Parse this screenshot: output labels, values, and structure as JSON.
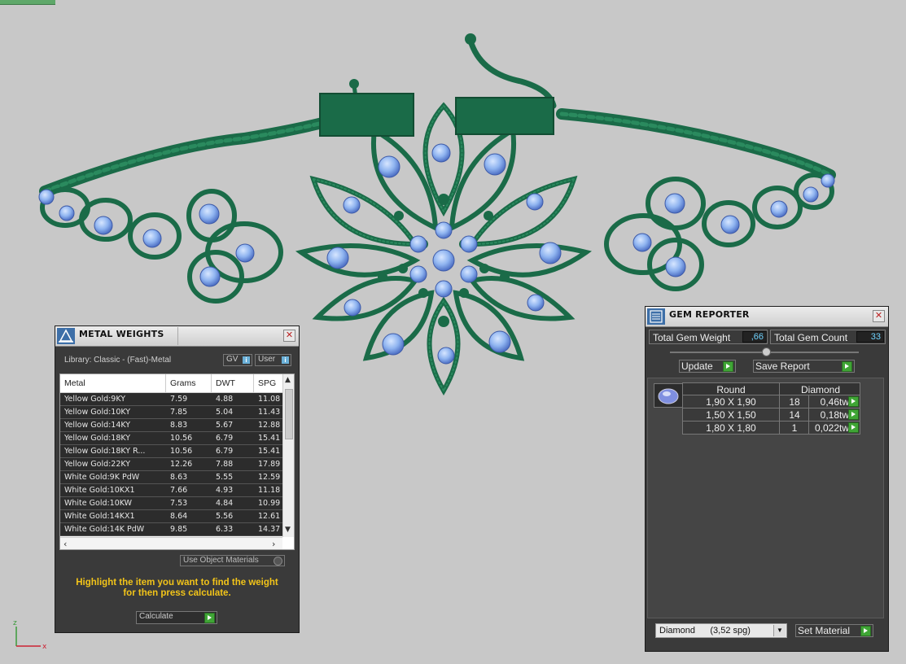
{
  "metal_weights": {
    "title": "METAL WEIGHTS",
    "library": "Library: Classic - (Fast)-Metal",
    "toggle_gv": "GV",
    "toggle_user": "User",
    "columns": [
      "Metal",
      "Grams",
      "DWT",
      "SPG"
    ],
    "rows": [
      [
        "Yellow Gold:9KY",
        "7.59",
        "4.88",
        "11.08"
      ],
      [
        "Yellow Gold:10KY",
        "7.85",
        "5.04",
        "11.43"
      ],
      [
        "Yellow Gold:14KY",
        "8.83",
        "5.67",
        "12.88"
      ],
      [
        "Yellow Gold:18KY",
        "10.56",
        "6.79",
        "15.41"
      ],
      [
        "Yellow Gold:18KY R...",
        "10.56",
        "6.79",
        "15.41"
      ],
      [
        "Yellow Gold:22KY",
        "12.26",
        "7.88",
        "17.89"
      ],
      [
        "White Gold:9K PdW",
        "8.63",
        "5.55",
        "12.59"
      ],
      [
        "White Gold:10KX1",
        "7.66",
        "4.93",
        "11.18"
      ],
      [
        "White Gold:10KW",
        "7.53",
        "4.84",
        "10.99"
      ],
      [
        "White Gold:14KX1",
        "8.64",
        "5.56",
        "12.61"
      ],
      [
        "White Gold:14K PdW",
        "9.85",
        "6.33",
        "14.37"
      ]
    ],
    "use_object_materials": "Use Object Materials",
    "hint_line1": "Highlight the item you want to find the weight",
    "hint_line2": "for then press calculate.",
    "calculate": "Calculate"
  },
  "gem_reporter": {
    "title": "GEM REPORTER",
    "total_weight_label": "Total Gem Weight",
    "total_weight_value": ",66",
    "total_count_label": "Total Gem Count",
    "total_count_value": "33",
    "update": "Update",
    "save_report": "Save Report",
    "shape_header": "Round",
    "material_header": "Diamond",
    "gems": [
      {
        "size": "1,90 X 1,90",
        "count": "18",
        "tw": "0,46tw"
      },
      {
        "size": "1,50 X 1,50",
        "count": "14",
        "tw": "0,18tw"
      },
      {
        "size": "1,80 X 1,80",
        "count": "1",
        "tw": "0,022tw"
      }
    ],
    "material_select": "Diamond      (3,52 spg)",
    "set_material": "Set Material"
  },
  "axis": {
    "x": "x",
    "z": "z"
  },
  "colors": {
    "metal_green": "#1a6b48",
    "gem_blue": "#8fb4f0",
    "hint_yellow": "#f2c419",
    "button_green": "#3fa535"
  }
}
